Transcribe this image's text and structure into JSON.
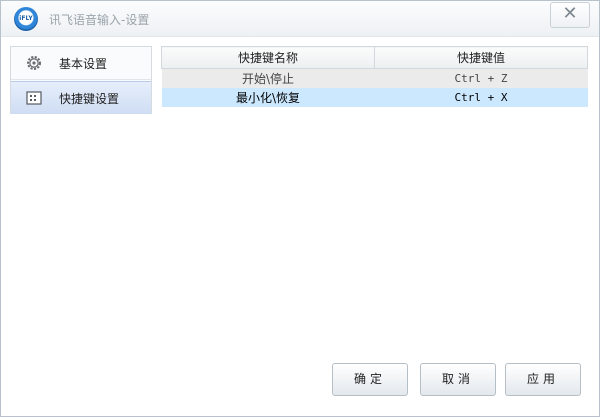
{
  "window": {
    "title": "讯飞语音输入-设置",
    "logo_text": "iFLY",
    "close_glyph": "✕"
  },
  "sidebar": {
    "items": [
      {
        "label": "基本设置",
        "icon": "gear-icon",
        "selected": false
      },
      {
        "label": "快捷键设置",
        "icon": "keyboard-icon",
        "selected": true
      }
    ]
  },
  "hotkey_table": {
    "columns": [
      "快捷键名称",
      "快捷键值"
    ],
    "rows": [
      {
        "name": "开始\\停止",
        "value": "Ctrl + Z"
      },
      {
        "name": "最小化\\恢复",
        "value": "Ctrl + X"
      }
    ]
  },
  "buttons": {
    "ok": "确定",
    "cancel": "取消",
    "apply": "应用"
  },
  "colors": {
    "selected_row": "#cce8ff",
    "sidebar_selected": "#cfddf3"
  }
}
